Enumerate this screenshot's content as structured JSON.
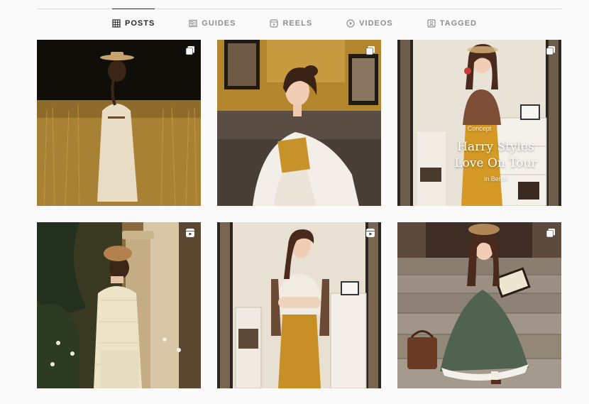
{
  "tabs": [
    {
      "label": "POSTS",
      "icon": "grid-icon",
      "active": true
    },
    {
      "label": "GUIDES",
      "icon": "guides-icon",
      "active": false
    },
    {
      "label": "REELS",
      "icon": "reels-icon",
      "active": false
    },
    {
      "label": "VIDEOS",
      "icon": "play-circle-icon",
      "active": false
    },
    {
      "label": "TAGGED",
      "icon": "tagged-icon",
      "active": false
    }
  ],
  "posts": [
    {
      "type": "carousel",
      "badge_icon": "carousel-icon"
    },
    {
      "type": "carousel",
      "badge_icon": "carousel-icon"
    },
    {
      "type": "carousel",
      "badge_icon": "carousel-icon",
      "overlay": {
        "small": "Concept",
        "line1": "Harry Styles",
        "line2": "Love On Tour",
        "place": "in Berlin"
      }
    },
    {
      "type": "reel",
      "badge_icon": "reel-icon"
    },
    {
      "type": "reel",
      "badge_icon": "reel-icon"
    },
    {
      "type": "carousel",
      "badge_icon": "carousel-icon"
    }
  ],
  "colors": {
    "active_tab": "#262626",
    "inactive_tab": "#8e8e8e",
    "divider": "#dbdbdb",
    "background": "#fafafa"
  }
}
